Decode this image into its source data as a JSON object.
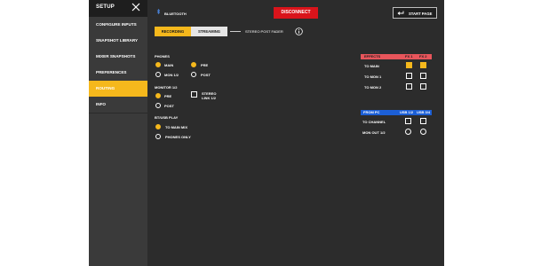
{
  "sidebar": {
    "title": "SETUP",
    "items": [
      {
        "label": "CONFIGURE INPUTS",
        "active": false
      },
      {
        "label": "SNAPSHOT LIBRARY",
        "active": false
      },
      {
        "label": "MIXER SNAPSHOTS",
        "active": false
      },
      {
        "label": "PREFERENCES",
        "active": false
      },
      {
        "label": "ROUTING",
        "active": true
      },
      {
        "label": "INFO",
        "active": false
      }
    ]
  },
  "topbar": {
    "bluetooth_label": "BLUETOOTH",
    "disconnect_label": "DISCONNECT",
    "start_page_label": "START PAGE"
  },
  "tabs": {
    "recording": "RECORDING",
    "streaming": "STREAMING",
    "selected": "RECORDING"
  },
  "stereo_post_fader_label": "STEREO POST FADER",
  "phones": {
    "title": "PHONES",
    "source_options": [
      {
        "label": "MAIN",
        "selected": true
      },
      {
        "label": "MON 1/2",
        "selected": false
      }
    ],
    "tap_options": [
      {
        "label": "PRE",
        "selected": true
      },
      {
        "label": "POST",
        "selected": false
      }
    ]
  },
  "monitor": {
    "title": "MONITOR 1/2",
    "options": [
      {
        "label": "PRE",
        "selected": true
      },
      {
        "label": "POST",
        "selected": false
      }
    ],
    "stereo_link_label": "STEREO LINK 1/2",
    "stereo_link_checked": false
  },
  "bt_usb_play": {
    "title": "BT/USB PLAY",
    "options": [
      {
        "label": "TO MAIN MIX",
        "selected": true
      },
      {
        "label": "PHONES ONLY",
        "selected": false
      }
    ]
  },
  "effects": {
    "header": "EFFECTS",
    "columns": [
      "FX 1",
      "FX 2"
    ],
    "rows": [
      {
        "label": "TO MAIN",
        "checked": [
          true,
          true
        ]
      },
      {
        "label": "TO MON 1",
        "checked": [
          false,
          false
        ]
      },
      {
        "label": "TO MON 2",
        "checked": [
          false,
          false
        ]
      }
    ],
    "header_color": "#e8555b"
  },
  "from_pc": {
    "header": "FROM PC",
    "columns": [
      "USB 1/2",
      "USB 3/4"
    ],
    "rows": [
      {
        "label": "TO CHANNEL",
        "type": "check"
      },
      {
        "label": "MON OUT 1/2",
        "type": "radio"
      }
    ],
    "header_color": "#1c5fd6"
  },
  "colors": {
    "accent": "#f5b81c",
    "disconnect": "#d9141b"
  }
}
